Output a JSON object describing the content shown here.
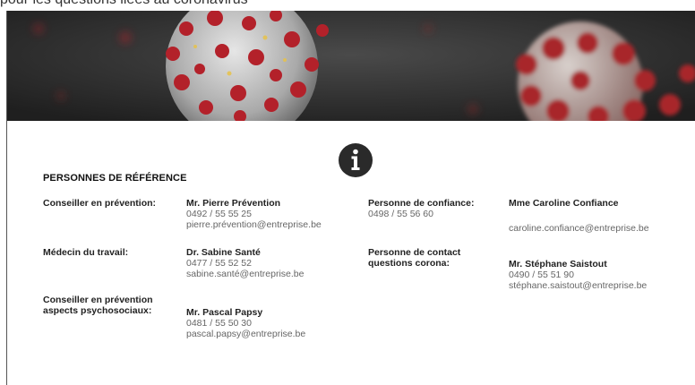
{
  "top_text": "pour les questions liées au coronavirus",
  "colors": {
    "banner_bg": "#2f2f2f",
    "virus_red": "#b3212a",
    "virus_grey": "#cfcfcf",
    "icon_dark": "#2a2a2a"
  },
  "icon": "info-icon",
  "heading": "PERSONNES DE RÉFÉRENCE",
  "left": [
    {
      "role_lines": [
        "Conseiller en prévention:"
      ],
      "name": "Mr. Pierre Prévention",
      "phone": "0492 / 55 55 25",
      "email": "pierre.prévention@entreprise.be"
    },
    {
      "role_lines": [
        "Médecin du travail:"
      ],
      "name": "Dr. Sabine Santé",
      "phone": "0477 / 55 52 52",
      "email": "sabine.santé@entreprise.be"
    },
    {
      "role_lines": [
        "Conseiller en prévention",
        "aspects psychosociaux:"
      ],
      "name": "Mr. Pascal Papsy",
      "phone": "0481 / 55 50 30",
      "email": "pascal.papsy@entreprise.be"
    }
  ],
  "right": [
    {
      "role_lines": [
        "Personne de confiance:"
      ],
      "role_phone": "0498 / 55 56 60",
      "name": "Mme Caroline Confiance",
      "email": "caroline.confiance@entreprise.be"
    },
    {
      "role_lines": [
        "Personne de contact",
        "questions corona:"
      ],
      "name": "Mr. Stéphane Saistout",
      "phone": "0490 / 55 51 90",
      "email": "stéphane.saistout@entreprise.be"
    }
  ]
}
